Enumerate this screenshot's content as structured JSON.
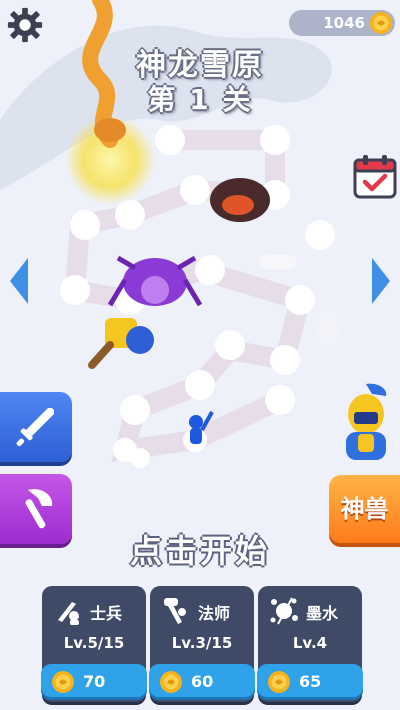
{
  "header": {
    "settings_icon": "gear-icon",
    "coins": "1046",
    "coin_icon": "coin-icon"
  },
  "level": {
    "map_name": "神龙雪原",
    "stage": "第 1 关"
  },
  "side": {
    "calendar_icon": "calendar-check-icon",
    "left_arrow_icon": "arrow-left-icon",
    "right_arrow_icon": "arrow-right-icon",
    "skill_icons": [
      "sword-icon",
      "axe-icon"
    ],
    "beast_label": "神兽"
  },
  "start_label": "点击开始",
  "upgrades": [
    {
      "icon": "soldier-icon",
      "name": "士兵",
      "level": "Lv.5/15",
      "cost": "70"
    },
    {
      "icon": "mage-icon",
      "name": "法师",
      "level": "Lv.3/15",
      "cost": "60"
    },
    {
      "icon": "ink-icon",
      "name": "墨水",
      "level": "Lv.4",
      "cost": "65"
    }
  ],
  "colors": {
    "card_bg": "#3f4a66",
    "cost_bg": "#2fa2ea",
    "sword_btn": "#4e86f2",
    "axe_btn": "#c456e8",
    "beast_btn": "#ff7a1a"
  }
}
